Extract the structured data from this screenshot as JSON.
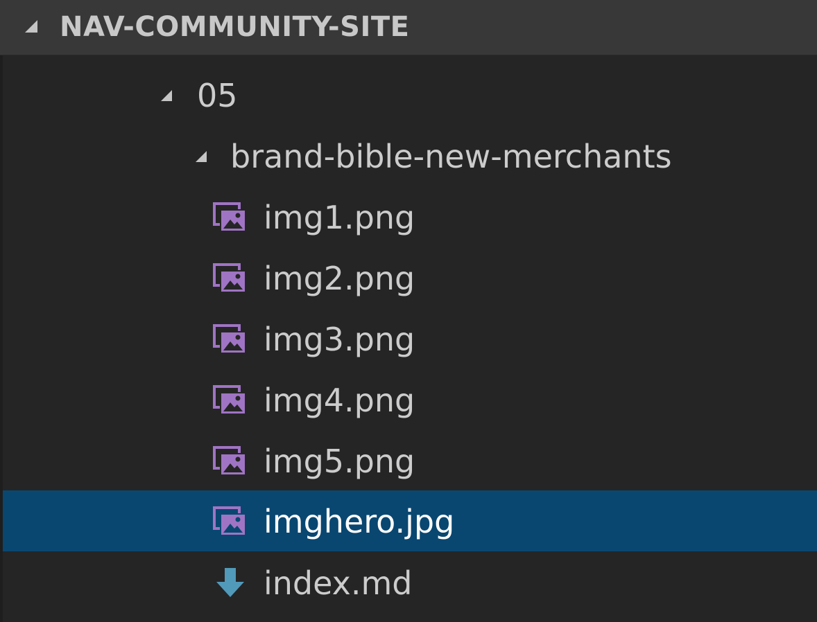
{
  "explorer": {
    "section_title": "NAV-COMMUNITY-SITE",
    "tree": [
      {
        "label": "05",
        "kind": "folder",
        "expanded": true
      },
      {
        "label": "brand-bible-new-merchants",
        "kind": "folder",
        "expanded": true
      },
      {
        "label": "img1.png",
        "kind": "file",
        "icon": "image-file-icon"
      },
      {
        "label": "img2.png",
        "kind": "file",
        "icon": "image-file-icon"
      },
      {
        "label": "img3.png",
        "kind": "file",
        "icon": "image-file-icon"
      },
      {
        "label": "img4.png",
        "kind": "file",
        "icon": "image-file-icon"
      },
      {
        "label": "img5.png",
        "kind": "file",
        "icon": "image-file-icon"
      },
      {
        "label": "imghero.jpg",
        "kind": "file",
        "icon": "image-file-icon",
        "selected": true
      },
      {
        "label": "index.md",
        "kind": "file",
        "icon": "markdown-download-icon"
      }
    ]
  },
  "colors": {
    "background": "#252526",
    "header_background": "#383838",
    "selection": "#094771",
    "image_icon": "#a074c4",
    "markdown_icon": "#519aba",
    "text": "#cccccc"
  }
}
